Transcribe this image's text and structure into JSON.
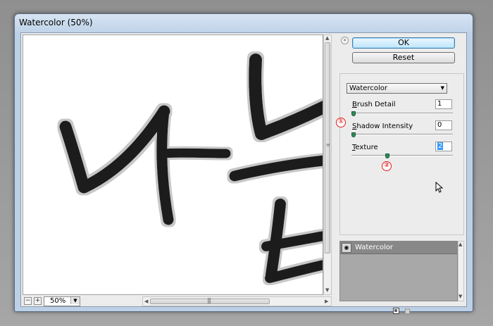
{
  "window": {
    "title": "Watercolor (50%)"
  },
  "buttons": {
    "ok": "OK",
    "reset": "Reset"
  },
  "filter": {
    "selected": "Watercolor"
  },
  "params": [
    {
      "accel": "B",
      "rest": "rush Detail",
      "value": "1",
      "level": 0.0
    },
    {
      "accel": "S",
      "rest": "hadow Intensity",
      "value": "0",
      "level": 0.0
    },
    {
      "accel": "T",
      "rest": "exture",
      "value": "2",
      "level": 0.33
    }
  ],
  "callouts": [
    "①",
    "②"
  ],
  "zoom": {
    "value": "50%",
    "zoom_out": "−",
    "zoom_in": "+"
  },
  "layers": [
    {
      "name": "Watercolor",
      "visible": true
    }
  ],
  "icons": [
    "collapse-icon",
    "eye-icon",
    "new-layer-icon",
    "trash-icon",
    "cursor-icon"
  ],
  "colors": {
    "ok_button": "#bee6fd",
    "callout": "#e01b1b",
    "slider_knob": "#2e8b57"
  }
}
